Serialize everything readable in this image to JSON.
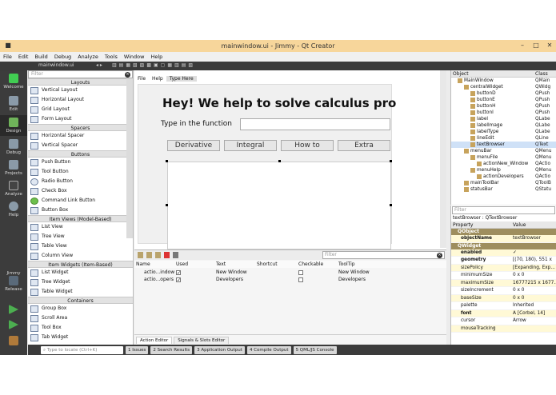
{
  "window": {
    "title": "mainwindow.ui - Jimmy - Qt Creator"
  },
  "menubar": [
    "File",
    "Edit",
    "Build",
    "Debug",
    "Analyze",
    "Tools",
    "Window",
    "Help"
  ],
  "toolbar": {
    "file_tab": "mainwindow.ui"
  },
  "modes": [
    {
      "label": "Welcome",
      "icon": "qt-logo-icon"
    },
    {
      "label": "Edit",
      "icon": "edit-icon"
    },
    {
      "label": "Design",
      "icon": "design-pencil-icon"
    },
    {
      "label": "Debug",
      "icon": "debug-bug-icon"
    },
    {
      "label": "Projects",
      "icon": "projects-wrench-icon"
    },
    {
      "label": "Analyze",
      "icon": "analyze-icon"
    },
    {
      "label": "Help",
      "icon": "help-icon"
    }
  ],
  "kit": {
    "project": "Jimmy",
    "build": "Release"
  },
  "widgetbox": {
    "filter_placeholder": "Filter",
    "sections": [
      {
        "title": "Layouts",
        "items": [
          "Vertical Layout",
          "Horizontal Layout",
          "Grid Layout",
          "Form Layout"
        ]
      },
      {
        "title": "Spacers",
        "items": [
          "Horizontal Spacer",
          "Vertical Spacer"
        ]
      },
      {
        "title": "Buttons",
        "items": [
          "Push Button",
          "Tool Button",
          "Radio Button",
          "Check Box",
          "Command Link Button",
          "Button Box"
        ]
      },
      {
        "title": "Item Views (Model-Based)",
        "items": [
          "List View",
          "Tree View",
          "Table View",
          "Column View"
        ]
      },
      {
        "title": "Item Widgets (Item-Based)",
        "items": [
          "List Widget",
          "Tree Widget",
          "Table Widget"
        ]
      },
      {
        "title": "Containers",
        "items": [
          "Group Box",
          "Scroll Area",
          "Tool Box",
          "Tab Widget"
        ]
      }
    ]
  },
  "form": {
    "menu": [
      "File",
      "Help",
      "Type Here"
    ],
    "heading": "Hey! We help to solve calculus pro",
    "function_label": "Type in the function",
    "buttons": [
      "Derivative",
      "Integral",
      "How to",
      "Extra"
    ]
  },
  "action_editor": {
    "filter_placeholder": "Filter",
    "columns": [
      "Name",
      "Used",
      "Text",
      "Shortcut",
      "Checkable",
      "ToolTip"
    ],
    "rows": [
      {
        "name": "actio...indow",
        "used": true,
        "text": "New Window",
        "shortcut": "",
        "checkable": false,
        "tooltip": "New Window"
      },
      {
        "name": "actio...opers",
        "used": true,
        "text": "Developers",
        "shortcut": "",
        "checkable": false,
        "tooltip": "Developers"
      }
    ],
    "tabs": [
      "Action Editor",
      "Signals & Slots Editor"
    ]
  },
  "object_inspector": {
    "headers": [
      "Object",
      "Class"
    ],
    "rows": [
      {
        "name": "MainWindow",
        "cls": "QMain",
        "level": 1
      },
      {
        "name": "centralWidget",
        "cls": "QWidg",
        "level": 2
      },
      {
        "name": "buttonD",
        "cls": "QPush",
        "level": 3
      },
      {
        "name": "buttonE",
        "cls": "QPush",
        "level": 3
      },
      {
        "name": "buttonH",
        "cls": "QPush",
        "level": 3
      },
      {
        "name": "buttonI",
        "cls": "QPush",
        "level": 3
      },
      {
        "name": "label",
        "cls": "QLabe",
        "level": 3
      },
      {
        "name": "labelImage",
        "cls": "QLabe",
        "level": 3
      },
      {
        "name": "labelType",
        "cls": "QLabe",
        "level": 3
      },
      {
        "name": "lineEdit",
        "cls": "QLine",
        "level": 3
      },
      {
        "name": "textBrowser",
        "cls": "QText",
        "level": 3
      },
      {
        "name": "menuBar",
        "cls": "QMenu",
        "level": 2
      },
      {
        "name": "menuFile",
        "cls": "QMenu",
        "level": 3
      },
      {
        "name": "actionNew_Window",
        "cls": "QActio",
        "level": 4
      },
      {
        "name": "menuHelp",
        "cls": "QMenu",
        "level": 3
      },
      {
        "name": "actionDevelopers",
        "cls": "QActio",
        "level": 4
      },
      {
        "name": "mainToolBar",
        "cls": "QToolB",
        "level": 2
      },
      {
        "name": "statusBar",
        "cls": "QStatu",
        "level": 2
      }
    ]
  },
  "property_editor": {
    "filter_placeholder": "Filter",
    "caption": "textBrowser : QTextBrowser",
    "headers": [
      "Property",
      "Value"
    ],
    "groups": [
      {
        "title": "QObject",
        "rows": [
          {
            "name": "objectName",
            "value": "textBrowser",
            "bold": true
          }
        ]
      },
      {
        "title": "QWidget",
        "rows": [
          {
            "name": "enabled",
            "value": "✓",
            "bold": true
          },
          {
            "name": "geometry",
            "value": "[(70, 180), 551 x",
            "bold": true
          },
          {
            "name": "sizePolicy",
            "value": "[Expanding, Exp..."
          },
          {
            "name": "minimumSize",
            "value": "0 x 0"
          },
          {
            "name": "maximumSize",
            "value": "16777215 x 1677..."
          },
          {
            "name": "sizeIncrement",
            "value": "0 x 0"
          },
          {
            "name": "baseSize",
            "value": "0 x 0"
          },
          {
            "name": "palette",
            "value": "Inherited"
          },
          {
            "name": "font",
            "value": "A [Corbel, 14]",
            "bold": true
          },
          {
            "name": "cursor",
            "value": "Arrow"
          },
          {
            "name": "mouseTracking",
            "value": ""
          }
        ]
      }
    ]
  },
  "statusbar": {
    "locate_placeholder": "Type to locate (Ctrl+K)",
    "panes": [
      "1 Issues",
      "2 Search Results",
      "3 Application Output",
      "4 Compile Output",
      "5 QML/JS Console"
    ]
  }
}
